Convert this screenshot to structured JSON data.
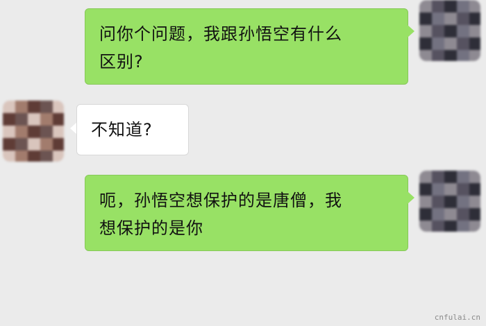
{
  "messages": [
    {
      "side": "sent",
      "text_line1": "问你个问题，我跟孙悟空有什么",
      "text_line2": "区别?"
    },
    {
      "side": "received",
      "text_line1": "不知道?"
    },
    {
      "side": "sent",
      "text_line1": "呃，孙悟空想保护的是唐僧，我",
      "text_line2": "想保护的是你"
    }
  ],
  "avatars": {
    "me": {
      "pixel_colors": [
        "#8e8a92",
        "#6b6270",
        "#3b3b45",
        "#565260",
        "#a79c96",
        "#4d4854",
        "#2e2e38",
        "#9a9aa4",
        "#c7c3c8",
        "#737281",
        "#1f1f28",
        "#d2d2da"
      ]
    },
    "other": {
      "pixel_colors": [
        "#d9c5bd",
        "#9c6a5f",
        "#6b3b36",
        "#a27c6d",
        "#c69a86",
        "#7a4a43",
        "#5f3c36",
        "#9e8d84",
        "#b3a39b",
        "#6c5452",
        "#7d6a55",
        "#b0a8a8"
      ]
    }
  },
  "watermark": "cnfulai.cn"
}
